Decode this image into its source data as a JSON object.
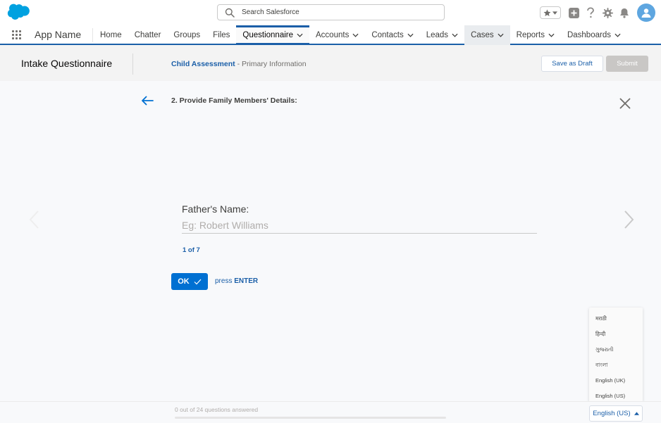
{
  "header": {
    "search_placeholder": "Search Salesforce",
    "icons": [
      "salesforce-cloud-logo",
      "search-icon",
      "star-icon",
      "chevron-down-icon",
      "add-icon",
      "help-icon",
      "gear-icon",
      "bell-icon",
      "user-avatar-icon"
    ]
  },
  "nav": {
    "app_name": "App Name",
    "items": [
      {
        "label": "Home",
        "dropdown": false
      },
      {
        "label": "Chatter",
        "dropdown": false
      },
      {
        "label": "Groups",
        "dropdown": false
      },
      {
        "label": "Files",
        "dropdown": false
      },
      {
        "label": "Questionnaire",
        "dropdown": true,
        "active": true
      },
      {
        "label": "Accounts",
        "dropdown": true
      },
      {
        "label": "Contacts",
        "dropdown": true
      },
      {
        "label": "Leads",
        "dropdown": true
      },
      {
        "label": "Cases",
        "dropdown": true
      },
      {
        "label": "Reports",
        "dropdown": true
      },
      {
        "label": "Dashboards",
        "dropdown": true
      }
    ]
  },
  "page_header": {
    "title": "Intake Questionnaire",
    "breadcrumb_link": "Child Assessment",
    "breadcrumb_rest": "- Primary Information",
    "save_draft_label": "Save as Draft",
    "submit_label": "Submit"
  },
  "question": {
    "title": "2. Provide Family Members' Details:",
    "field_label": "Father's Name:",
    "field_placeholder": "Eg: Robert Williams",
    "field_value": "",
    "counter": "1 of 7",
    "ok_label": "OK",
    "hint_prefix": "press",
    "hint_key": "ENTER"
  },
  "language_menu": {
    "options": [
      "मराठी",
      "हिन्दी",
      "ગુજરાતી",
      "বাংলা",
      "English (UK)",
      "English (US)"
    ],
    "selected": "English (US)"
  },
  "footer": {
    "progress_text": "0 out of 24 questions answered",
    "progress_fraction": 0
  },
  "colors": {
    "brand": "#1b5fa8",
    "button_primary": "#0070d2",
    "avatar": "#5ea6e0",
    "logo": "#00a1e0"
  }
}
